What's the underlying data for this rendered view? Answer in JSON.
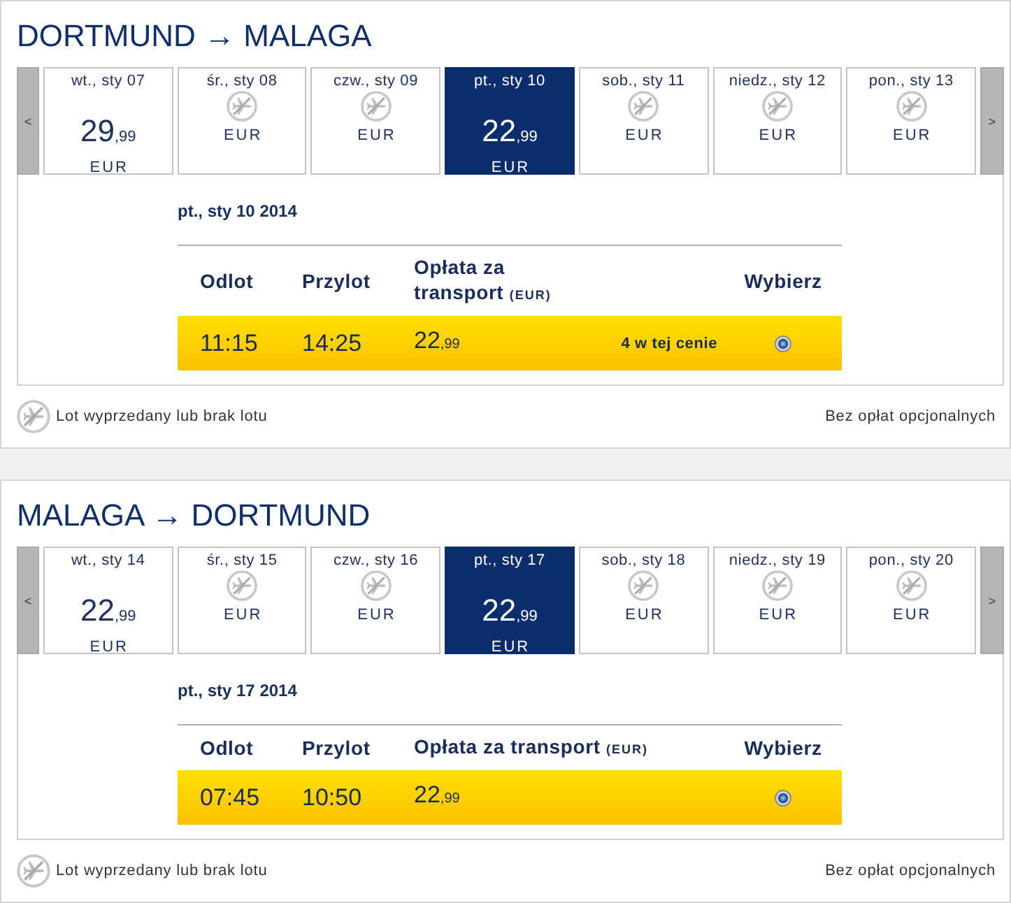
{
  "journeys": [
    {
      "title": "DORTMUND → MALAGA",
      "previous_button": "<",
      "next_button": ">",
      "days": [
        {
          "label": "wt., sty 07",
          "available": true,
          "price": "29",
          "price_fraction": ",99",
          "currency": "EUR",
          "selected": false
        },
        {
          "label": "śr., sty 08",
          "available": false,
          "currency": "EUR",
          "selected": false
        },
        {
          "label": "czw., sty 09",
          "available": false,
          "currency": "EUR",
          "selected": false
        },
        {
          "label": "pt., sty 10",
          "available": true,
          "price": "22",
          "price_fraction": ",99",
          "currency": "EUR",
          "selected": true
        },
        {
          "label": "sob., sty 11",
          "available": false,
          "currency": "EUR",
          "selected": false
        },
        {
          "label": "niedz., sty 12",
          "available": false,
          "currency": "EUR",
          "selected": false
        },
        {
          "label": "pon., sty 13",
          "available": false,
          "currency": "EUR",
          "selected": false
        }
      ],
      "date_heading": "pt., sty 10 2014",
      "columns": [
        {
          "kind": "departure",
          "label": "Odlot"
        },
        {
          "kind": "arrival",
          "label": "Przylot"
        },
        {
          "kind": "fare",
          "label": "Opłata za transport",
          "unit": "(EUR)"
        },
        {
          "kind": "select",
          "label": "Wybierz"
        }
      ],
      "flights": [
        {
          "departure": "11:15",
          "arrival": "14:25",
          "price": "22",
          "price_fraction": ",99",
          "availability": "4 w tej cenie",
          "selected": true
        }
      ],
      "legend": "Lot wyprzedany lub brak lotu",
      "fees_note": "Bez opłat opcjonalnych"
    },
    {
      "title": "MALAGA → DORTMUND",
      "previous_button": "<",
      "next_button": ">",
      "days": [
        {
          "label": "wt., sty 14",
          "available": true,
          "price": "22",
          "price_fraction": ",99",
          "currency": "EUR",
          "selected": false
        },
        {
          "label": "śr., sty 15",
          "available": false,
          "currency": "EUR",
          "selected": false
        },
        {
          "label": "czw., sty 16",
          "available": false,
          "currency": "EUR",
          "selected": false
        },
        {
          "label": "pt., sty 17",
          "available": true,
          "price": "22",
          "price_fraction": ",99",
          "currency": "EUR",
          "selected": true
        },
        {
          "label": "sob., sty 18",
          "available": false,
          "currency": "EUR",
          "selected": false
        },
        {
          "label": "niedz., sty 19",
          "available": false,
          "currency": "EUR",
          "selected": false
        },
        {
          "label": "pon., sty 20",
          "available": false,
          "currency": "EUR",
          "selected": false
        }
      ],
      "date_heading": "pt., sty 17 2014",
      "columns": [
        {
          "kind": "departure",
          "label": "Odlot"
        },
        {
          "kind": "arrival",
          "label": "Przylot"
        },
        {
          "kind": "fare",
          "label": "Opłata za transport",
          "unit": "(EUR)"
        },
        {
          "kind": "select",
          "label": "Wybierz"
        }
      ],
      "flights": [
        {
          "departure": "07:45",
          "arrival": "10:50",
          "price": "22",
          "price_fraction": ",99",
          "selected": true
        }
      ],
      "legend": "Lot wyprzedany lub brak lotu",
      "fees_note": "Bez opłat opcjonalnych"
    }
  ]
}
